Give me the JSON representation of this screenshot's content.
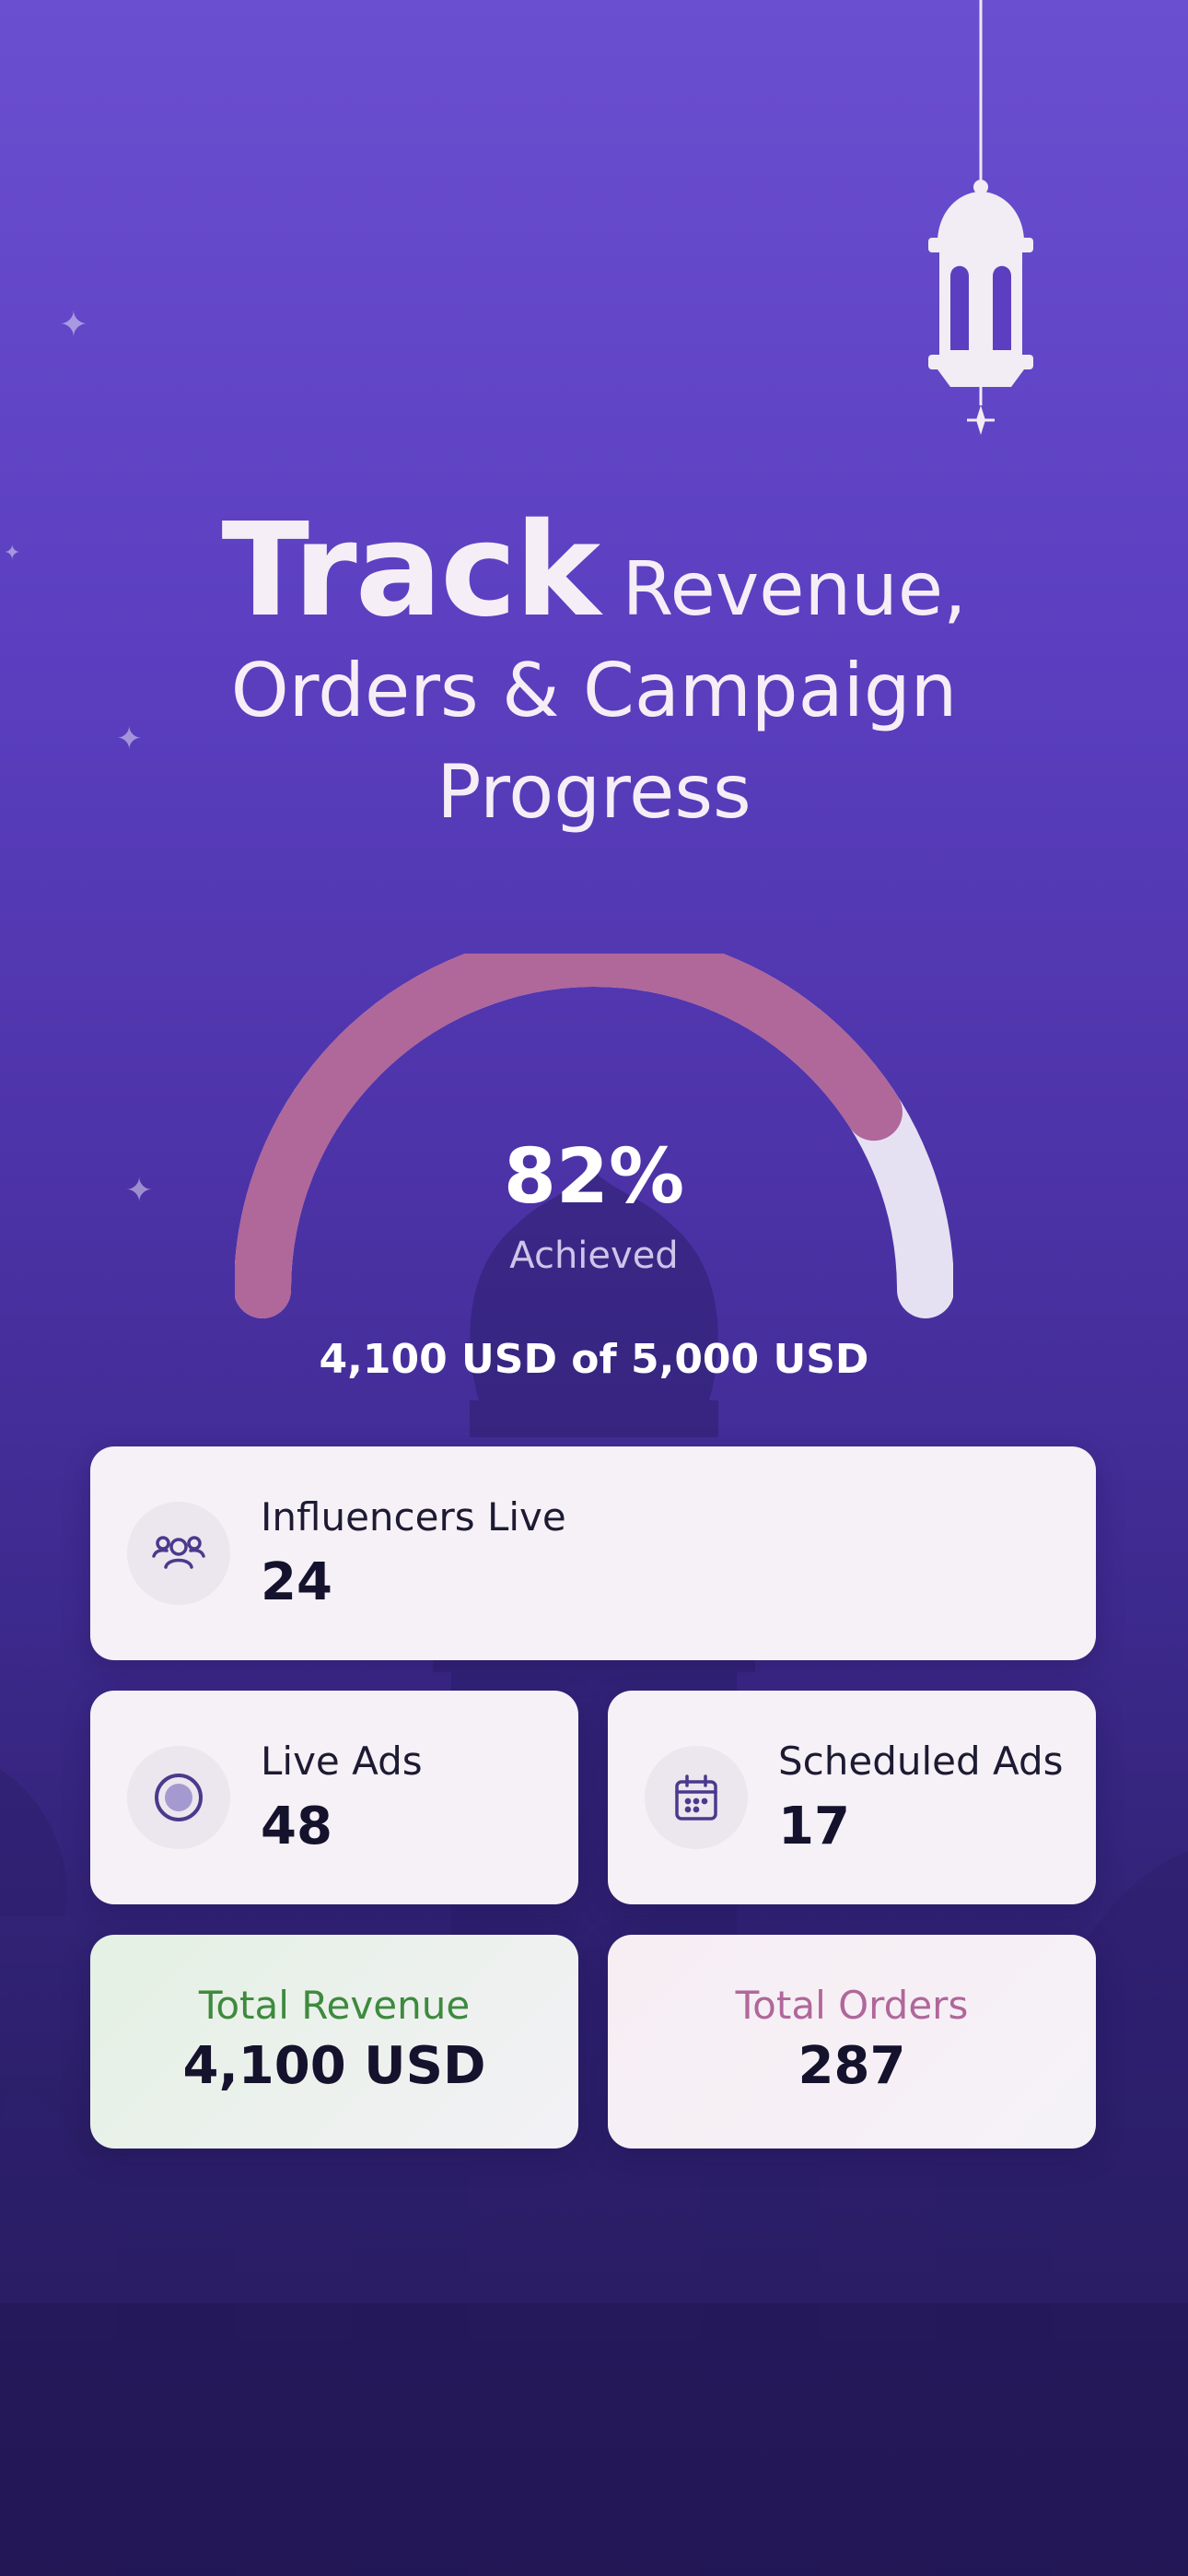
{
  "headline": {
    "strong": "Track",
    "line1_rest": "Revenue,",
    "line2": "Orders & Campaign",
    "line3": "Progress"
  },
  "progress": {
    "percent_text": "82%",
    "fraction": 0.82,
    "label": "Achieved",
    "summary": "4,100 USD of 5,000 USD"
  },
  "stats": {
    "influencers": {
      "label": "Influencers Live",
      "value": "24",
      "icon": "people-icon"
    },
    "live_ads": {
      "label": "Live Ads",
      "value": "48",
      "icon": "live-target-icon"
    },
    "scheduled_ads": {
      "label": "Scheduled Ads",
      "value": "17",
      "icon": "calendar-icon"
    },
    "revenue": {
      "label": "Total Revenue",
      "value": "4,100 USD"
    },
    "orders": {
      "label": "Total Orders",
      "value": "287"
    }
  },
  "colors": {
    "accent_arc": "#b0679a",
    "track_arc": "#e6e1f2",
    "revenue_label": "#3e8a3e",
    "orders_label": "#b0679a",
    "icon": "#4a3a8c"
  }
}
